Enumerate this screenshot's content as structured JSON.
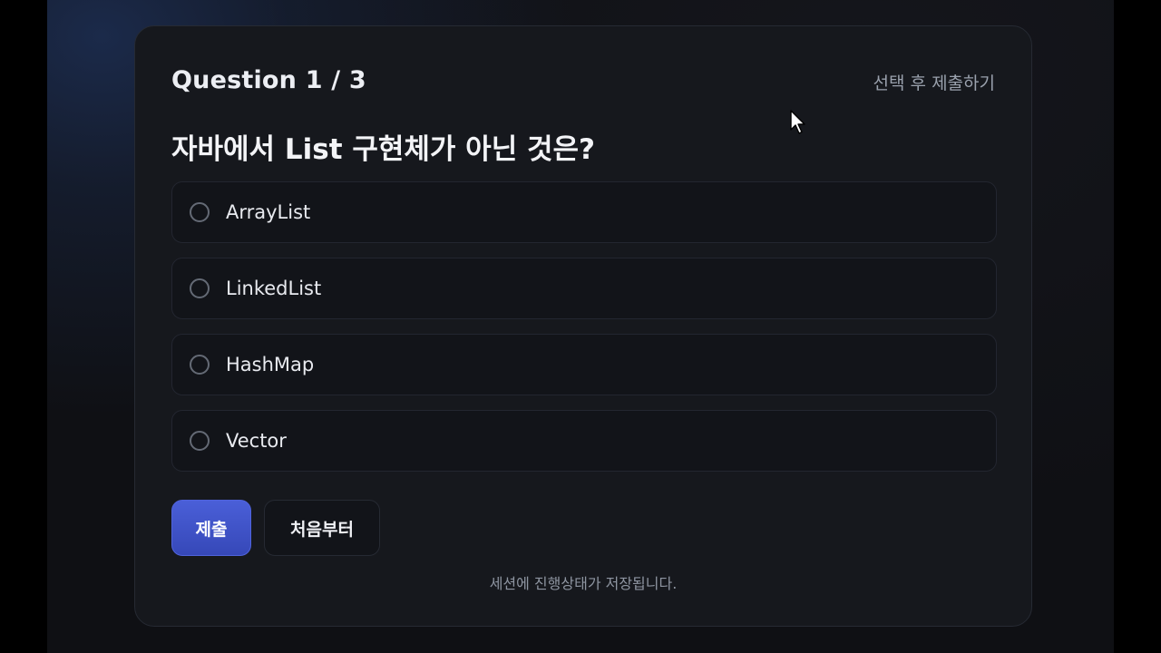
{
  "quiz": {
    "counter": "Question 1 / 3",
    "hint": "선택 후 제출하기",
    "question": "자바에서 List 구현체가 아닌 것은?",
    "options": [
      {
        "label": "ArrayList"
      },
      {
        "label": "LinkedList"
      },
      {
        "label": "HashMap"
      },
      {
        "label": "Vector"
      }
    ]
  },
  "buttons": {
    "submit": "제출",
    "restart": "처음부터"
  },
  "footer": {
    "note": "세션에 진행상태가 저장됩니다."
  },
  "colors": {
    "accent": "#3f52c9",
    "card_background": "#16181d",
    "option_background": "#121419"
  }
}
